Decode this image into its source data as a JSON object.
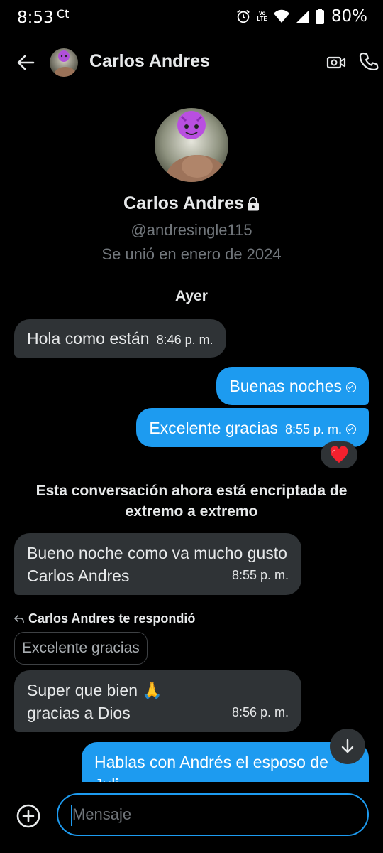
{
  "status_bar": {
    "time": "8:53",
    "carrier_icon": "Ct",
    "icons": [
      "alarm-icon",
      "volte-icon",
      "wifi-icon",
      "signal-icon",
      "battery-icon"
    ],
    "volte_top": "Vo",
    "volte_bottom": "LTE",
    "battery": "80%"
  },
  "header": {
    "name": "Carlos Andres",
    "icons": [
      "back-arrow-icon",
      "video-icon",
      "phone-icon"
    ]
  },
  "profile": {
    "name": "Carlos Andres",
    "handle": "@andresingle115",
    "joined": "Se unió en enero de 2024",
    "lock_icon": "lock-icon"
  },
  "day_separator": "Ayer",
  "messages": [
    {
      "direction": "received",
      "text": "Hola como están",
      "time": "8:46 p. m."
    },
    {
      "direction": "sent",
      "text": "Buenas noches",
      "time": ""
    },
    {
      "direction": "sent",
      "text": "Excelente gracias",
      "time": "8:55 p. m.",
      "reaction": "❤️"
    },
    {
      "direction": "received",
      "text": "Bueno noche como va mucho gusto Carlos Andres",
      "time": "8:55 p. m."
    },
    {
      "direction": "received",
      "text": "Super que bien 🙏 gracias a Dios",
      "time": "8:56 p. m.",
      "reply_label": "Carlos Andres te respondió",
      "reply_quote": "Excelente gracias"
    },
    {
      "direction": "sent",
      "text": "Hablas con Andrés el esposo de Juli",
      "time": ""
    }
  ],
  "encryption_notice": "Esta conversación ahora está encriptada de extremo a extremo",
  "composer": {
    "placeholder": "Mensaje"
  },
  "colors": {
    "background": "#000000",
    "sent_bubble": "#1d9bf0",
    "received_bubble": "#2f3336",
    "secondary_text": "#71767b"
  }
}
